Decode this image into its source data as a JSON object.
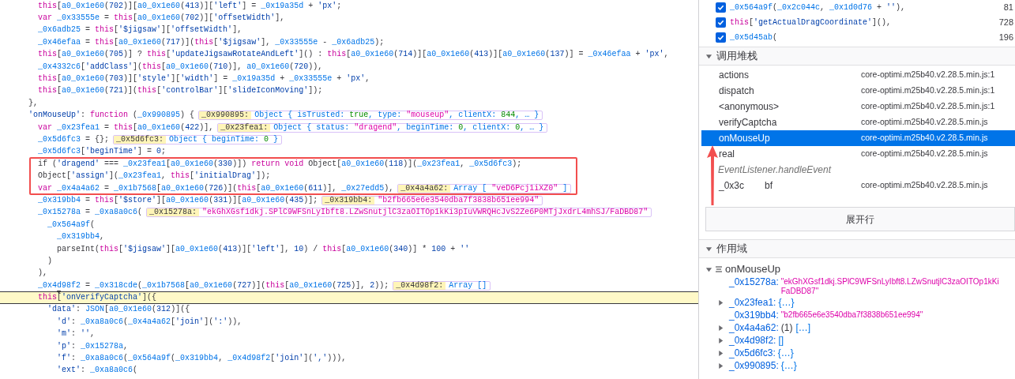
{
  "code_lines": [
    {
      "text": "        this[a0_0x1e60(702)][a0_0x1e60(413)]['left'] = _0x19a35d + 'px';",
      "paused": false
    },
    {
      "text": "        var _0x33555e = this[a0_0x1e60(702)]['offsetWidth'],",
      "paused": false
    },
    {
      "text": "        _0x6adb25 = this['$jigsaw']['offsetWidth'],",
      "paused": false
    },
    {
      "text": "        _0x46efaa = this[a0_0x1e60(717)](this['$jigsaw'], _0x33555e - _0x6adb25);",
      "paused": false
    },
    {
      "text": "        this[a0_0x1e60(705)] ? this['updateJigsawRotateAndLeft']() : this[a0_0x1e60(714)][a0_0x1e60(413)][a0_0x1e60(137)] = _0x46efaa + 'px',",
      "paused": false
    },
    {
      "text": "        _0x4332c6['addClass'](this[a0_0x1e60(710)], a0_0x1e60(720)),",
      "paused": false
    },
    {
      "text": "        this[a0_0x1e60(703)]['style']['width'] = _0x19a35d + _0x33555e + 'px',",
      "paused": false
    },
    {
      "text": "        this[a0_0x1e60(721)](this['controlBar']['slideIconMoving']);",
      "paused": false
    },
    {
      "text": "      },",
      "paused": false
    },
    {
      "text": "      'onMouseUp': function (_0x990895) {",
      "paused": false,
      "preview": {
        "label": "_0x990895:",
        "value": "Object { isTrusted: true, type: \"mouseup\", clientX: 844, … }"
      }
    },
    {
      "text": "        var _0x23fea1 = this[a0_0x1e60(422)],",
      "paused": false,
      "preview": {
        "label": "_0x23fea1:",
        "value": "Object { status: \"dragend\", beginTime: 0, clientX: 0, … }"
      }
    },
    {
      "text": "        _0x5d6fc3 = {};",
      "paused": false,
      "preview": {
        "label": "_0x5d6fc3:",
        "value": "Object { beginTime: 0 }"
      }
    },
    {
      "text": "        _0x5d6fc3['beginTime'] = 0;",
      "paused": false
    },
    {
      "text": "        if ('dragend' === _0x23fea1[a0_0x1e60(330)]) return void Object[a0_0x1e60(118)](_0x23fea1, _0x5d6fc3);",
      "paused": false
    },
    {
      "text": "        Object['assign'](_0x23fea1, this['initialDrag']);",
      "paused": false
    },
    {
      "text": "        var _0x4a4a62 = _0x1b7568[a0_0x1e60(726)](this[a0_0x1e60(611)], _0x27edd5),",
      "paused": false,
      "preview": {
        "label": "_0x4a4a62:",
        "value": "Array [ \"veD6Pcj1iXZ0\" ]"
      }
    },
    {
      "text": "        _0x319bb4 = this['$store'][a0_0x1e60(331)][a0_0x1e60(435)];",
      "paused": false,
      "preview": {
        "label": "_0x319bb4:",
        "value": "\"b2fb665e6e3540dba7f3838b651ee994\""
      }
    },
    {
      "text": "        _0x15278a = _0xa8a0c6(",
      "paused": false,
      "preview": {
        "label": "_0x15278a:",
        "value": "\"ekGhXGsf1dkj.SPlC9WFSnLyIbft8.LZwSnutjlC3zaOITOp1kKi3pIuVWRQHcJvS2Ze6P0MTjJxdrL4mhSJ/FaDBD87\""
      }
    },
    {
      "text": "          _0x564a9f(",
      "paused": false
    },
    {
      "text": "            _0x319bb4,",
      "paused": false
    },
    {
      "text": "            parseInt(this['$jigsaw'][a0_0x1e60(413)]['left'], 10) / this[a0_0x1e60(340)] * 100 + ''",
      "paused": false
    },
    {
      "text": "          )",
      "paused": false
    },
    {
      "text": "        ),",
      "paused": false
    },
    {
      "text": "        _0x4d98f2 = _0x318cde(_0x1b7568[a0_0x1e60(727)](this[a0_0x1e60(725)], 2));",
      "paused": false,
      "preview": {
        "label": "_0x4d98f2:",
        "value": "Array []"
      }
    },
    {
      "text": "        this['onVerifyCaptcha']({",
      "paused": true
    },
    {
      "text": "          'data': JSON[a0_0x1e60(312)]({",
      "paused": false
    },
    {
      "text": "            'd': _0xa8a0c6(_0x4a4a62['join'](':')),",
      "paused": false
    },
    {
      "text": "            'm': '',",
      "paused": false
    },
    {
      "text": "            'p': _0x15278a,",
      "paused": false
    },
    {
      "text": "            'f': _0xa8a0c6(_0x564a9f(_0x319bb4, _0x4d98f2['join'](','))),",
      "paused": false
    },
    {
      "text": "            'ext': _0xa8a0c6(",
      "paused": false
    }
  ],
  "breakpoints": [
    {
      "code": "_0x564a9f(_0x2c044c, _0x1d0d76 + ''),",
      "line": "81",
      "checked": true
    },
    {
      "code": "this['getActualDragCoordinate'](),",
      "line": "728",
      "checked": true
    },
    {
      "code": "_0x5d45ab(",
      "line": "196",
      "checked": true
    }
  ],
  "call_stack": {
    "title": "调用堆栈",
    "expanded": true,
    "frames": [
      {
        "kind": "frame",
        "name": "actions",
        "location": "core-optimi.m25b40.v2.28.5.min.js:1",
        "selected": false
      },
      {
        "kind": "frame",
        "name": "dispatch",
        "location": "core-optimi.m25b40.v2.28.5.min.js:1",
        "selected": false
      },
      {
        "kind": "frame",
        "name": "<anonymous>",
        "location": "core-optimi.m25b40.v2.28.5.min.js:1",
        "selected": false
      },
      {
        "kind": "frame",
        "name": "verifyCaptcha",
        "location": "core-optimi.m25b40.v2.28.5.min.js",
        "selected": false
      },
      {
        "kind": "frame",
        "name": "onMouseUp",
        "location": "core-optimi.m25b40.v2.28.5.min.js",
        "selected": true
      },
      {
        "kind": "frame",
        "name": "real",
        "location": "core-optimi.m25b40.v2.28.5.min.js",
        "selected": false
      },
      {
        "kind": "group",
        "name": "EventListener.handleEvent"
      },
      {
        "kind": "frame",
        "name": "_0x3c",
        "name_end": "bf",
        "location": "core-optimi.m25b40.v2.28.5.min.js",
        "selected": false
      }
    ]
  },
  "expand_rows_button": "展开行",
  "scopes": {
    "title": "作用域",
    "expanded": true,
    "tree": [
      {
        "name": "onMouseUp",
        "expanded": true,
        "children": [
          {
            "kind": "string",
            "name": "_0x15278a:",
            "value_lines": [
              "\"ekGhXGsf1dkj.SPlC9WFSnLyIbft8.LZwSnutjlC3zaOITOp1kKi",
              "FaDBD87\""
            ]
          },
          {
            "kind": "object",
            "name": "_0x23fea1:",
            "value": "{…}",
            "expanded": false
          },
          {
            "kind": "string",
            "name": "_0x319bb4:",
            "value_lines": [
              "\"b2fb665e6e3540dba7f3838b651ee994\""
            ]
          },
          {
            "kind": "array",
            "name": "_0x4a4a62:",
            "count": "(1)",
            "value": "[…]",
            "expanded": false
          },
          {
            "kind": "array",
            "name": "_0x4d98f2:",
            "value": "[]",
            "expanded": false
          },
          {
            "kind": "object",
            "name": "_0x5d6fc3:",
            "value": "{…}",
            "expanded": false
          },
          {
            "kind": "object",
            "name": "_0x990895:",
            "value": "{…}",
            "expanded": false
          }
        ]
      }
    ]
  }
}
